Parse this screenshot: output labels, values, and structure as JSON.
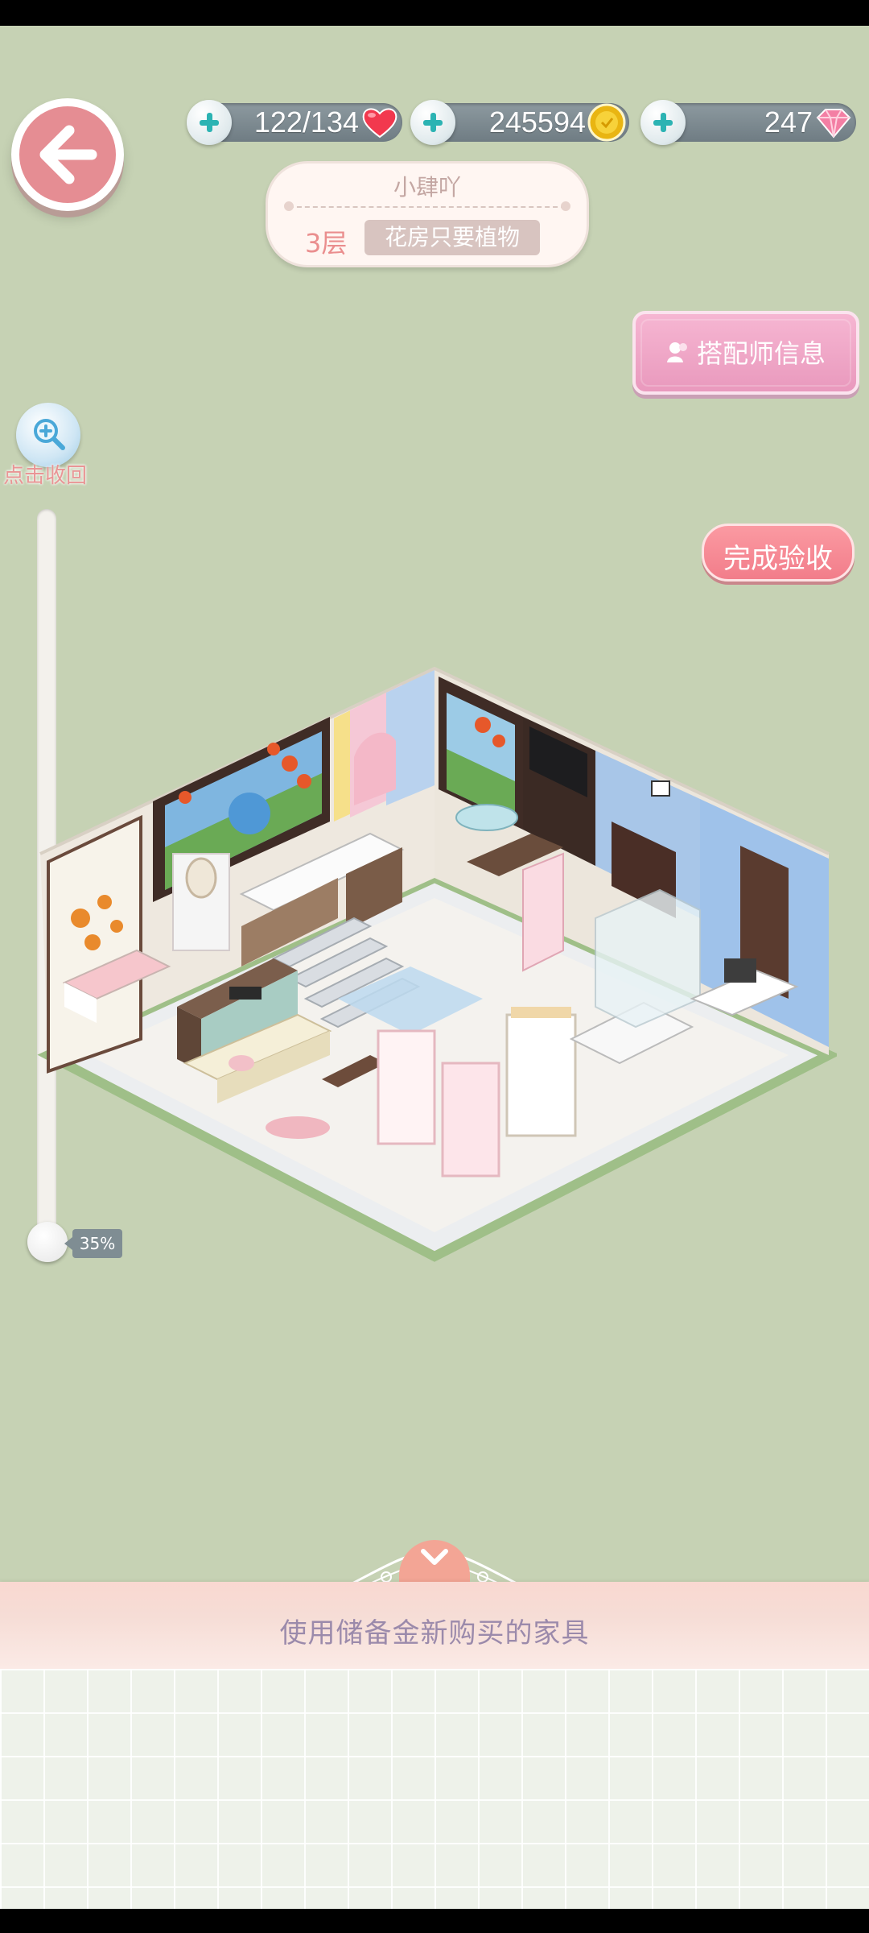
{
  "resources": {
    "stamina": {
      "value": "122/134",
      "icon": "heart-icon"
    },
    "coins": {
      "value": "245594",
      "icon": "coin-icon"
    },
    "gems": {
      "value": "247",
      "icon": "diamond-icon"
    }
  },
  "plaque": {
    "owner": "小肆吖",
    "floor": "3层",
    "theme": "花房只要植物"
  },
  "buttons": {
    "designer_info": "搭配师信息",
    "complete": "完成验收"
  },
  "zoom": {
    "label": "点击收回",
    "percent_label": "35%",
    "level": 0.35
  },
  "bottom": {
    "banner": "使用储备金新购买的家具"
  },
  "colors": {
    "background": "#c6d2b4",
    "accent_pink": "#e58d93",
    "teal_plus": "#2cb3b3"
  }
}
